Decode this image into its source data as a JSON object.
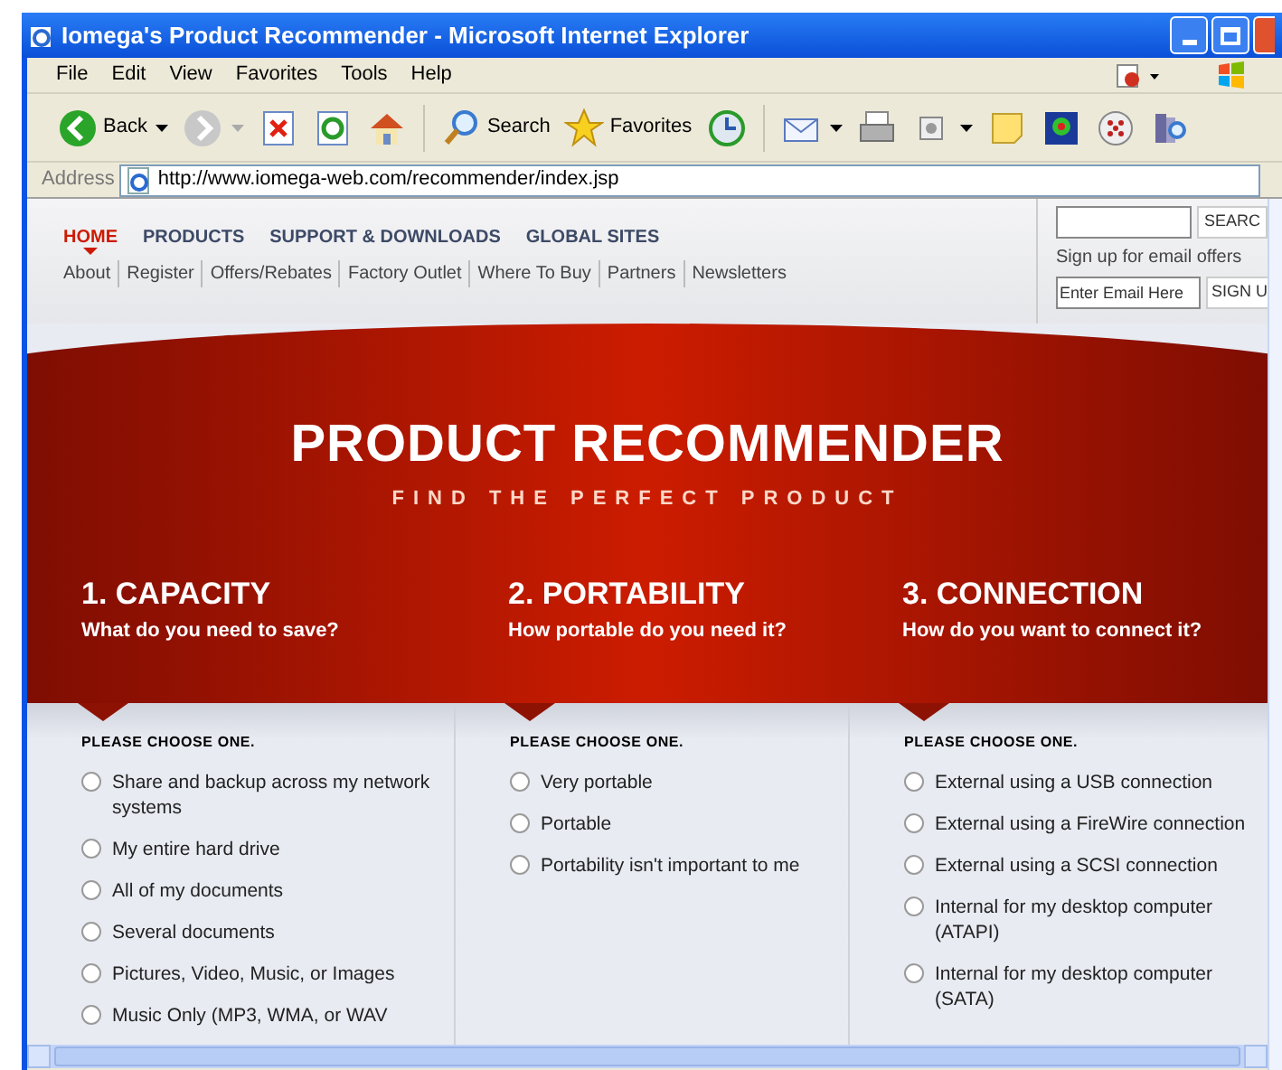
{
  "window": {
    "title": "Iomega's Product Recommender - Microsoft Internet Explorer"
  },
  "menu": [
    "File",
    "Edit",
    "View",
    "Favorites",
    "Tools",
    "Help"
  ],
  "toolbar": [
    {
      "kind": "back",
      "label": "Back",
      "dropdown": true
    },
    {
      "kind": "forward",
      "dropdown": true
    },
    {
      "kind": "stop",
      "dropdown": false
    },
    {
      "kind": "refresh",
      "dropdown": false
    },
    {
      "kind": "home",
      "dropdown": false
    },
    {
      "kind": "search",
      "label": "Search",
      "dropdown": false
    },
    {
      "kind": "favorites",
      "label": "Favorites",
      "dropdown": false
    },
    {
      "kind": "history",
      "dropdown": false
    },
    {
      "kind": "mail",
      "dropdown": true
    },
    {
      "kind": "print",
      "dropdown": false
    },
    {
      "kind": "edit",
      "dropdown": true
    },
    {
      "kind": "note",
      "dropdown": false
    },
    {
      "kind": "flower",
      "dropdown": false
    },
    {
      "kind": "dots",
      "dropdown": false
    },
    {
      "kind": "research",
      "dropdown": false
    }
  ],
  "address": {
    "label": "Address",
    "url": "http://www.iomega-web.com/recommender/index.jsp"
  },
  "site": {
    "main_nav": [
      {
        "label": "HOME",
        "selected": true
      },
      {
        "label": "PRODUCTS",
        "selected": false
      },
      {
        "label": "SUPPORT & DOWNLOADS",
        "selected": false
      },
      {
        "label": "GLOBAL SITES",
        "selected": false
      }
    ],
    "sub_nav": [
      "About",
      "Register",
      "Offers/Rebates",
      "Factory Outlet",
      "Where To Buy",
      "Partners",
      "Newsletters"
    ],
    "search_button": "SEARC",
    "email": {
      "label": "Sign up for email offers",
      "value": "Enter Email Here",
      "button": "SIGN U"
    },
    "hero": {
      "title": "PRODUCT RECOMMENDER",
      "subtitle": "FIND THE PERFECT PRODUCT"
    },
    "steps": [
      {
        "title": "1. CAPACITY",
        "question": "What do you need to save?",
        "prompt": "PLEASE CHOOSE ONE.",
        "options": [
          {
            "label": "Share and backup across my network systems",
            "selected": false
          },
          {
            "label": "My entire hard drive",
            "selected": false
          },
          {
            "label": "All of my documents",
            "selected": false
          },
          {
            "label": "Several documents",
            "selected": false
          },
          {
            "label": "Pictures, Video, Music, or Images",
            "selected": false
          },
          {
            "label": "Music Only (MP3, WMA, or WAV",
            "selected": false
          }
        ]
      },
      {
        "title": "2. PORTABILITY",
        "question": "How portable do you need it?",
        "prompt": "PLEASE CHOOSE ONE.",
        "options": [
          {
            "label": "Very portable",
            "selected": false
          },
          {
            "label": "Portable",
            "selected": false
          },
          {
            "label": "Portability isn't important to me",
            "selected": false
          }
        ]
      },
      {
        "title": "3. CONNECTION",
        "question": "How do you want to connect it?",
        "prompt": "PLEASE CHOOSE ONE.",
        "options": [
          {
            "label": "External using a USB connection",
            "selected": false
          },
          {
            "label": "External using a FireWire connection",
            "selected": false
          },
          {
            "label": "External using a SCSI connection",
            "selected": false
          },
          {
            "label": "Internal for my desktop computer (ATAPI)",
            "selected": false
          },
          {
            "label": "Internal for my desktop computer (SATA)",
            "selected": false
          }
        ]
      }
    ]
  }
}
